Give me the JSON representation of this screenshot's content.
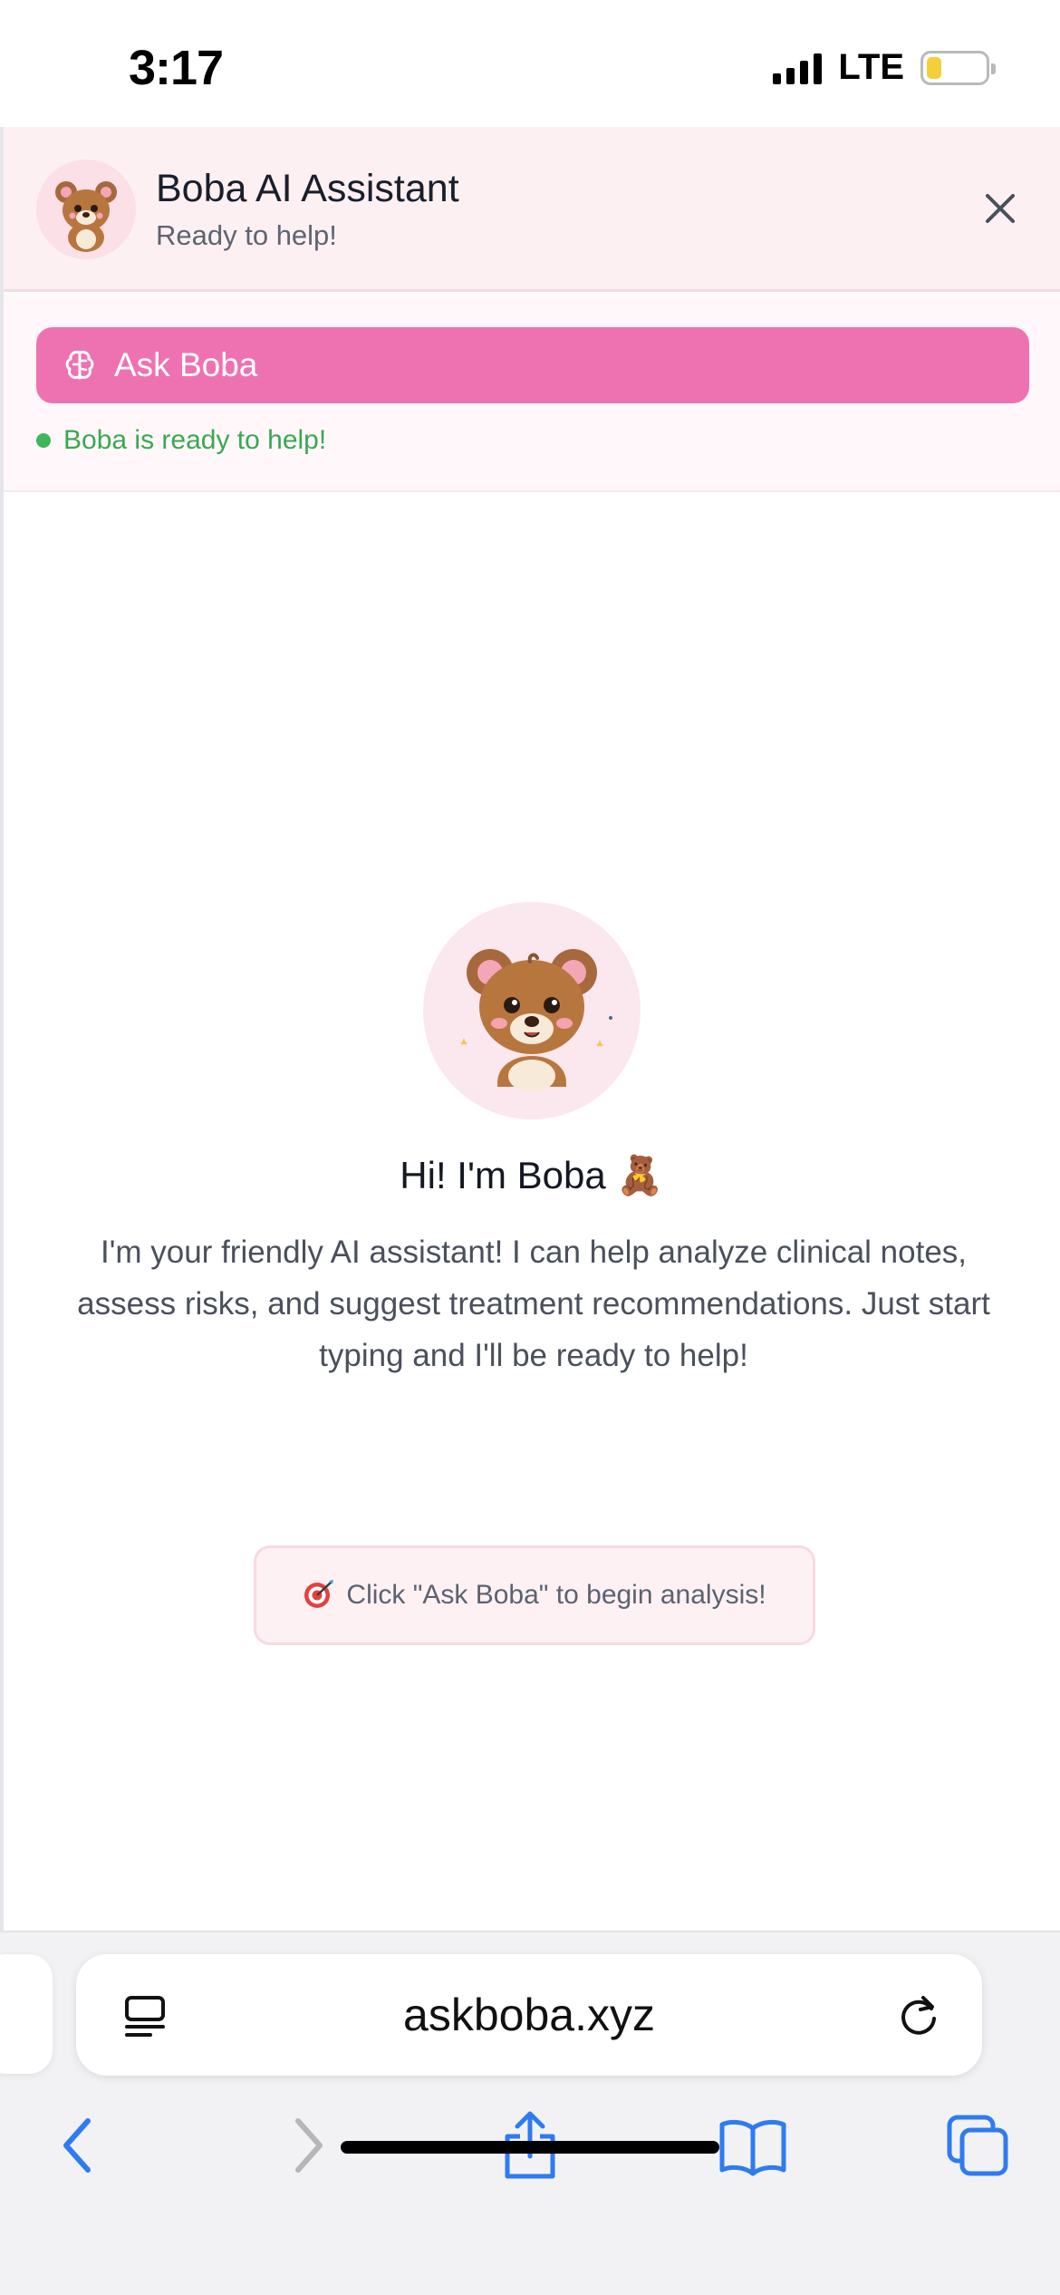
{
  "status_bar": {
    "time": "3:17",
    "network": "LTE",
    "battery_level": 0.25,
    "battery_color": "#f4cf3a"
  },
  "header": {
    "title": "Boba AI Assistant",
    "subtitle": "Ready to help!"
  },
  "toolbar": {
    "ask_label": "Ask Boba",
    "status_text": "Boba is ready to help!",
    "accent": "#ee72b2",
    "status_color": "#39a852"
  },
  "welcome": {
    "title": "Hi! I'm Boba 🧸",
    "body": "I'm your friendly AI assistant! I can help analyze clinical notes, assess risks, and suggest treatment recommendations. Just start typing and I'll be ready to help!",
    "hint": "Click \"Ask Boba\" to begin analysis!"
  },
  "browser": {
    "url": "askboba.xyz"
  },
  "icons": [
    "bear-avatar-icon",
    "close-icon",
    "brain-icon",
    "teddy-bear-icon",
    "dart-icon",
    "reader-icon",
    "reload-icon",
    "back-icon",
    "forward-icon",
    "share-icon",
    "bookmarks-icon",
    "tabs-icon"
  ]
}
